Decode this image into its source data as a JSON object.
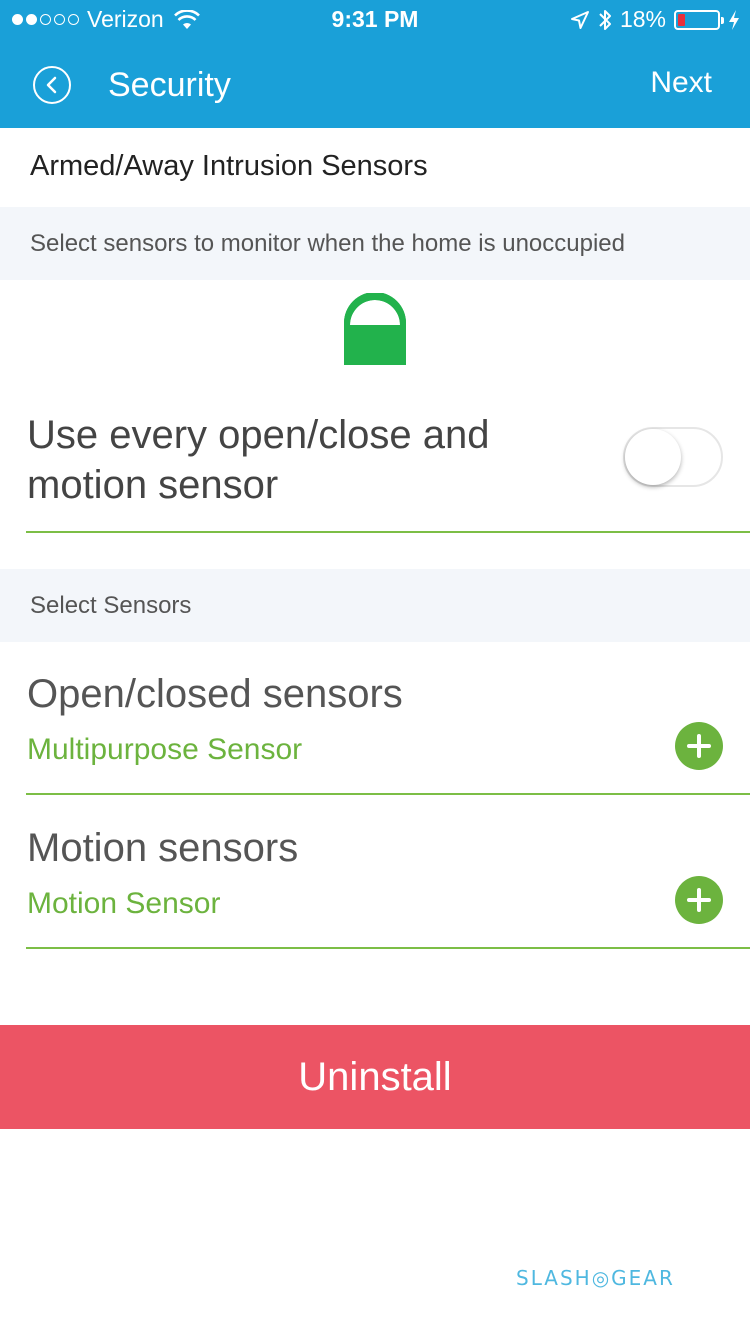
{
  "status_bar": {
    "carrier": "Verizon",
    "time": "9:31 PM",
    "battery_percent_label": "18%",
    "battery_level": 0.18
  },
  "nav": {
    "title": "Security",
    "next_label": "Next"
  },
  "section_title": "Armed/Away Intrusion Sensors",
  "description": "Select sensors to monitor when the home is unoccupied",
  "toggle_row": {
    "label": "Use every open/close and motion sensor",
    "on": false
  },
  "select_header": "Select Sensors",
  "sensors": [
    {
      "title": "Open/closed sensors",
      "selected": "Multipurpose Sensor"
    },
    {
      "title": "Motion sensors",
      "selected": "Motion Sensor"
    }
  ],
  "uninstall_label": "Uninstall",
  "watermark": "SLASH◎GEAR",
  "colors": {
    "header": "#1aa0d8",
    "accent_green": "#6cb33e",
    "uninstall_red": "#ec5464",
    "banner_bg": "#f3f6fa"
  }
}
